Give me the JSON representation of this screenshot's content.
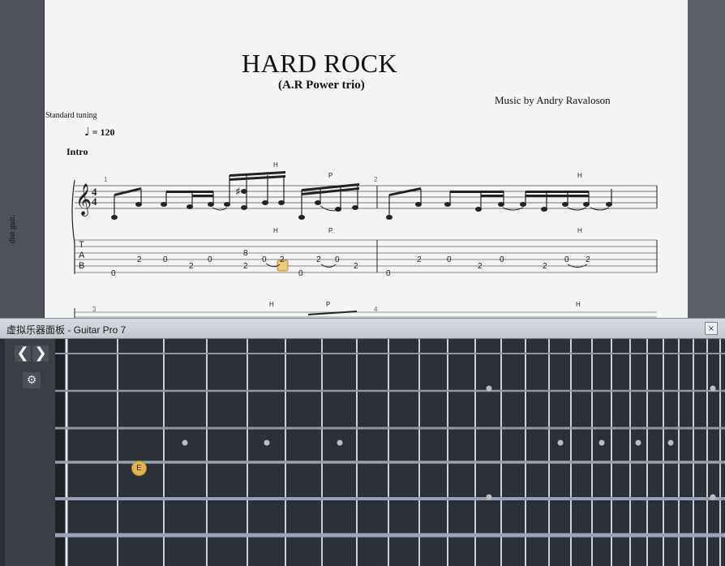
{
  "score": {
    "title": "HARD ROCK",
    "subtitle": "(A.R Power trio)",
    "credit": "Music by Andry Ravaloson",
    "tuning": "Standard tuning",
    "tempo": "= 120",
    "section": "Intro",
    "track_label": "dist guit.",
    "time_signature": {
      "numerator": "4",
      "denominator": "4"
    },
    "tab_clef": [
      "T",
      "A",
      "B"
    ],
    "measure_numbers": [
      "1",
      "2",
      "3",
      "4"
    ],
    "technique_marks": [
      "H",
      "P",
      "H",
      "H",
      "P",
      "H",
      "H",
      "P",
      "H"
    ],
    "accidental": "♯",
    "tab_numbers": [
      "0",
      "2",
      "0",
      "2",
      "0",
      "8",
      "2",
      "0",
      "2",
      "0",
      "2",
      "0",
      "2",
      "0",
      "2",
      "0",
      "2",
      "0",
      "2",
      "0",
      "2"
    ],
    "highlighted_note": "2"
  },
  "panel": {
    "title": "虚拟乐器面板 - Guitar Pro 7",
    "close_glyph": "×",
    "prev_glyph": "❮",
    "next_glyph": "❯",
    "settings_glyph": "⚙",
    "active_note": "E"
  },
  "colors": {
    "page": "#f4f4f4",
    "fretboard": "#2c3038",
    "string": "#9aa4b8",
    "fret": "#cfd3da",
    "note_marker": "#e1b24d"
  }
}
